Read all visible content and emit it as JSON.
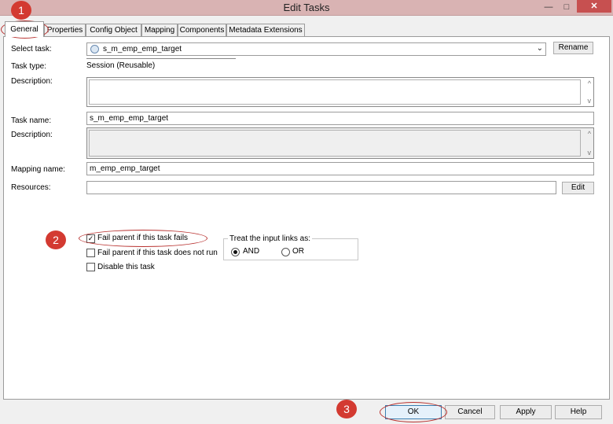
{
  "window": {
    "title": "Edit Tasks",
    "minimize_glyph": "—",
    "maximize_glyph": "□",
    "close_glyph": "✕"
  },
  "tabs": [
    {
      "label": "General",
      "active": true
    },
    {
      "label": "Properties"
    },
    {
      "label": "Config Object"
    },
    {
      "label": "Mapping"
    },
    {
      "label": "Components"
    },
    {
      "label": "Metadata Extensions"
    }
  ],
  "form": {
    "select_task_label": "Select task:",
    "select_task_value": "s_m_emp_emp_target",
    "rename_button": "Rename",
    "task_type_label": "Task type:",
    "task_type_value": "Session (Reusable)",
    "description_label": "Description:",
    "task_name_label": "Task name:",
    "task_name_value": "s_m_emp_emp_target",
    "description2_label": "Description:",
    "mapping_name_label": "Mapping name:",
    "mapping_name_value": "m_emp_emp_target",
    "resources_label": "Resources:",
    "resources_value": "",
    "edit_button": "Edit"
  },
  "options": {
    "fail_parent_label": "Fail parent if this task fails",
    "fail_parent_checked": true,
    "fail_parent_not_run_label": "Fail parent if this task does not run",
    "fail_parent_not_run_checked": false,
    "disable_label": "Disable this task",
    "disable_checked": false
  },
  "input_links": {
    "legend": "Treat the input links as:",
    "and_label": "AND",
    "or_label": "OR",
    "selected": "AND"
  },
  "footer": {
    "ok": "OK",
    "cancel": "Cancel",
    "apply": "Apply",
    "help": "Help"
  },
  "annotations": {
    "marker1": "1",
    "marker2": "2",
    "marker3": "3"
  },
  "colors": {
    "titlebar": "#d9b3b3",
    "close_button": "#c75050",
    "annotation_red": "#d33a31"
  }
}
